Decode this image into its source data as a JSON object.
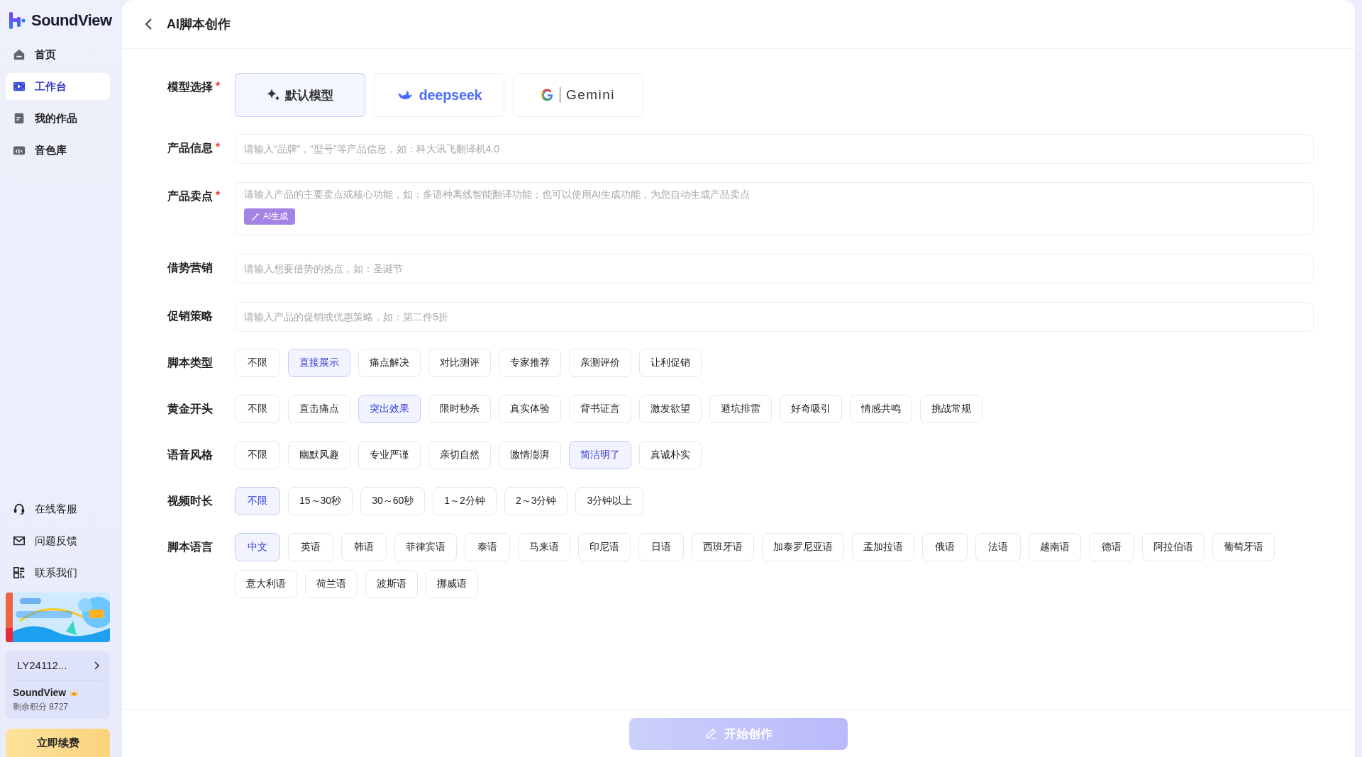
{
  "app": {
    "name": "SoundView"
  },
  "nav": [
    {
      "label": "首页",
      "selected": false
    },
    {
      "label": "工作台",
      "selected": true
    },
    {
      "label": "我的作品",
      "selected": false
    },
    {
      "label": "音色库",
      "selected": false
    }
  ],
  "support_links": [
    {
      "label": "在线客服"
    },
    {
      "label": "问题反馈"
    },
    {
      "label": "联系我们"
    }
  ],
  "account": {
    "id": "LY24112...",
    "name": "SoundView",
    "points": "剩余积分 8727"
  },
  "renew_button": "立即续费",
  "header": {
    "title": "AI脚本创作"
  },
  "model": {
    "label": "模型选择",
    "required_mark": "*",
    "options": [
      {
        "label": "默认模型",
        "selected": true
      },
      {
        "label": "deepseek",
        "selected": false
      },
      {
        "label": "Gemini",
        "selected": false
      }
    ]
  },
  "fields": [
    {
      "kind": "input",
      "label": "产品信息",
      "required_mark": "*",
      "placeholder": "请输入“品牌”，“型号”等产品信息，如：科大讯飞翻译机4.0"
    },
    {
      "kind": "textarea",
      "label": "产品卖点",
      "required_mark": "*",
      "placeholder": "请输入产品的主要卖点或核心功能，如：多语种离线智能翻译功能；也可以使用AI生成功能，为您自动生成产品卖点",
      "ai_button": "AI生成"
    },
    {
      "kind": "input",
      "label": "借势营销",
      "placeholder": "请输入想要借势的热点，如：圣诞节"
    },
    {
      "kind": "input",
      "label": "促销策略",
      "placeholder": "请输入产品的促销或优惠策略，如：第二件5折"
    }
  ],
  "option_groups": [
    {
      "label": "脚本类型",
      "options": [
        {
          "label": "不限",
          "selected": false
        },
        {
          "label": "直接展示",
          "selected": true
        },
        {
          "label": "痛点解决",
          "selected": false
        },
        {
          "label": "对比测评",
          "selected": false
        },
        {
          "label": "专家推荐",
          "selected": false
        },
        {
          "label": "亲测评价",
          "selected": false
        },
        {
          "label": "让利促销",
          "selected": false
        }
      ]
    },
    {
      "label": "黄金开头",
      "options": [
        {
          "label": "不限",
          "selected": false
        },
        {
          "label": "直击痛点",
          "selected": false
        },
        {
          "label": "突出效果",
          "selected": true
        },
        {
          "label": "限时秒杀",
          "selected": false
        },
        {
          "label": "真实体验",
          "selected": false
        },
        {
          "label": "背书证言",
          "selected": false
        },
        {
          "label": "激发欲望",
          "selected": false
        },
        {
          "label": "避坑排雷",
          "selected": false
        },
        {
          "label": "好奇吸引",
          "selected": false
        },
        {
          "label": "情感共鸣",
          "selected": false
        },
        {
          "label": "挑战常规",
          "selected": false
        }
      ]
    },
    {
      "label": "语音风格",
      "options": [
        {
          "label": "不限",
          "selected": false
        },
        {
          "label": "幽默风趣",
          "selected": false
        },
        {
          "label": "专业严谨",
          "selected": false
        },
        {
          "label": "亲切自然",
          "selected": false
        },
        {
          "label": "激情澎湃",
          "selected": false
        },
        {
          "label": "简洁明了",
          "selected": true
        },
        {
          "label": "真诚朴实",
          "selected": false
        }
      ]
    },
    {
      "label": "视频时长",
      "options": [
        {
          "label": "不限",
          "selected": true
        },
        {
          "label": "15～30秒",
          "selected": false
        },
        {
          "label": "30～60秒",
          "selected": false
        },
        {
          "label": "1～2分钟",
          "selected": false
        },
        {
          "label": "2～3分钟",
          "selected": false
        },
        {
          "label": "3分钟以上",
          "selected": false
        }
      ]
    },
    {
      "label": "脚本语言",
      "options": [
        {
          "label": "中文",
          "selected": true
        },
        {
          "label": "英语",
          "selected": false
        },
        {
          "label": "韩语",
          "selected": false
        },
        {
          "label": "菲律宾语",
          "selected": false
        },
        {
          "label": "泰语",
          "selected": false
        },
        {
          "label": "马来语",
          "selected": false
        },
        {
          "label": "印尼语",
          "selected": false
        },
        {
          "label": "日语",
          "selected": false
        },
        {
          "label": "西班牙语",
          "selected": false
        },
        {
          "label": "加泰罗尼亚语",
          "selected": false
        },
        {
          "label": "孟加拉语",
          "selected": false
        },
        {
          "label": "俄语",
          "selected": false
        },
        {
          "label": "法语",
          "selected": false
        },
        {
          "label": "越南语",
          "selected": false
        },
        {
          "label": "德语",
          "selected": false
        },
        {
          "label": "阿拉伯语",
          "selected": false
        },
        {
          "label": "葡萄牙语",
          "selected": false
        },
        {
          "label": "意大利语",
          "selected": false
        },
        {
          "label": "荷兰语",
          "selected": false
        },
        {
          "label": "波斯语",
          "selected": false
        },
        {
          "label": "挪威语",
          "selected": false
        }
      ]
    }
  ],
  "submit": {
    "label": "开始创作",
    "disabled": true
  }
}
